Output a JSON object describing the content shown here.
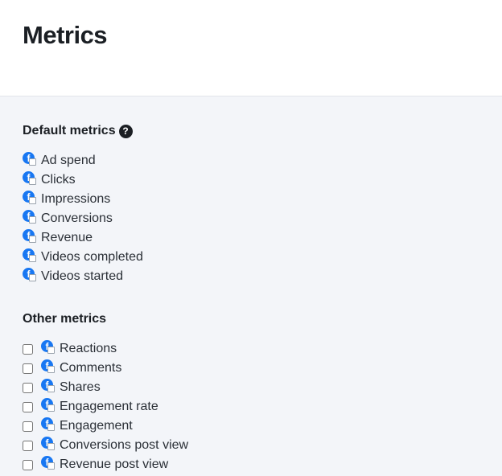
{
  "header": {
    "title": "Metrics"
  },
  "default_metrics": {
    "title": "Default metrics",
    "help_glyph": "?",
    "items": [
      {
        "label": "Ad spend"
      },
      {
        "label": "Clicks"
      },
      {
        "label": "Impressions"
      },
      {
        "label": "Conversions"
      },
      {
        "label": "Revenue"
      },
      {
        "label": "Videos completed"
      },
      {
        "label": "Videos started"
      }
    ]
  },
  "other_metrics": {
    "title": "Other metrics",
    "items": [
      {
        "label": "Reactions",
        "checked": false
      },
      {
        "label": "Comments",
        "checked": false
      },
      {
        "label": "Shares",
        "checked": false
      },
      {
        "label": "Engagement rate",
        "checked": false
      },
      {
        "label": "Engagement",
        "checked": false
      },
      {
        "label": "Conversions post view",
        "checked": false
      },
      {
        "label": "Revenue post view",
        "checked": false
      }
    ]
  },
  "icons": {
    "metric_source": "facebook-icon",
    "help": "help-icon"
  },
  "colors": {
    "facebook": "#1877f2",
    "background": "#f3f5f9"
  }
}
